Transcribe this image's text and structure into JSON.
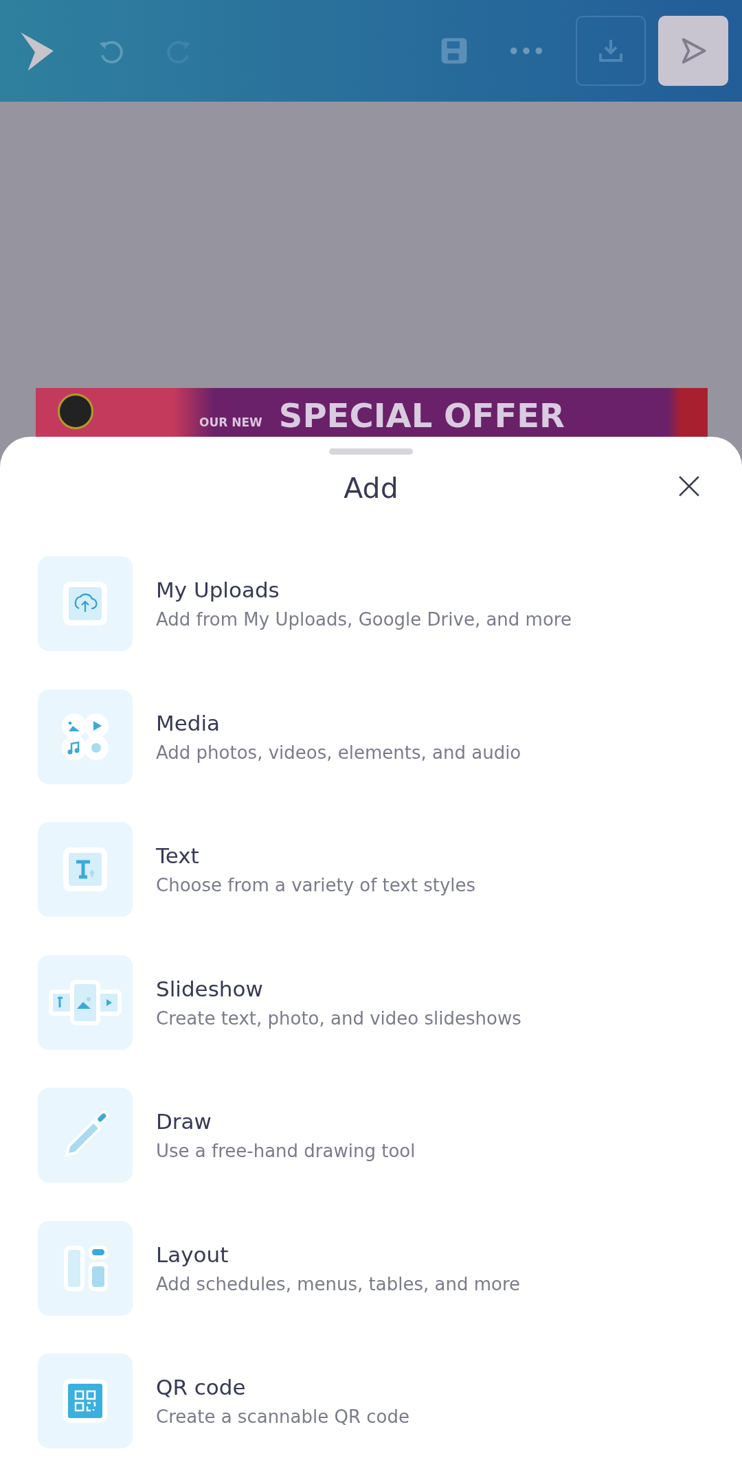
{
  "banner": {
    "kicker": "OUR NEW",
    "headline": "SPECIAL OFFER"
  },
  "sheet": {
    "title": "Add",
    "items": [
      {
        "kind": "uploads",
        "title": "My Uploads",
        "subtitle": "Add from My Uploads, Google Drive, and more"
      },
      {
        "kind": "media",
        "title": "Media",
        "subtitle": "Add photos, videos, elements, and audio"
      },
      {
        "kind": "text",
        "title": "Text",
        "subtitle": "Choose from a variety of text styles"
      },
      {
        "kind": "slideshow",
        "title": "Slideshow",
        "subtitle": "Create text, photo, and video slideshows"
      },
      {
        "kind": "draw",
        "title": "Draw",
        "subtitle": "Use a free-hand drawing tool"
      },
      {
        "kind": "layout",
        "title": "Layout",
        "subtitle": "Add schedules, menus, tables, and more"
      },
      {
        "kind": "qr",
        "title": "QR code",
        "subtitle": "Create a scannable QR code"
      }
    ]
  }
}
